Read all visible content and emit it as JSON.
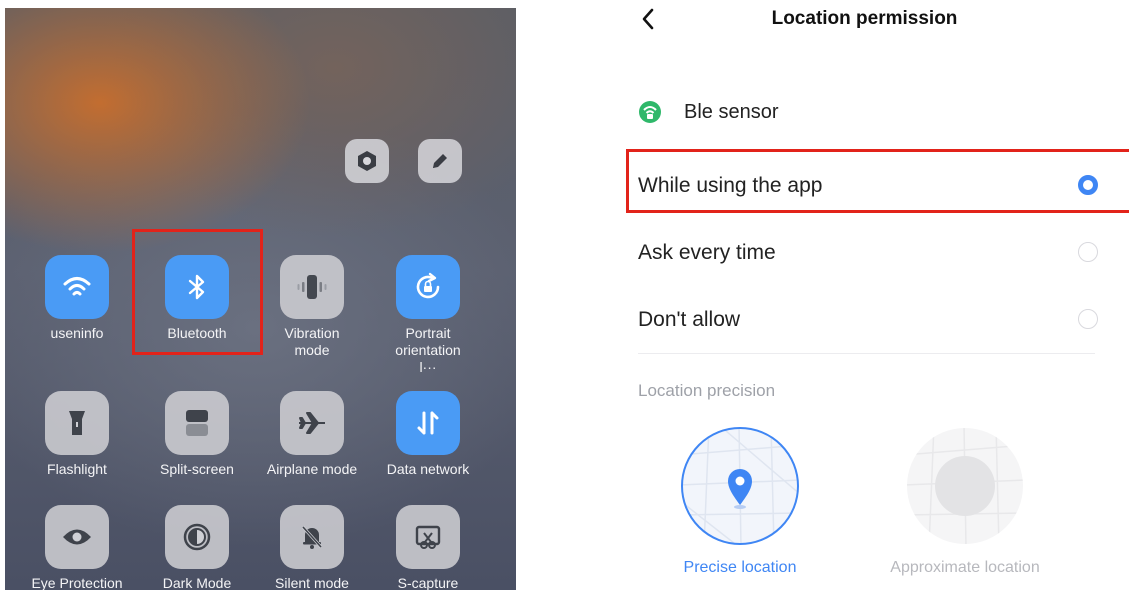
{
  "control_center": {
    "top_buttons": [
      {
        "icon": "settings-hex-icon"
      },
      {
        "icon": "pencil-icon"
      }
    ],
    "tiles": [
      {
        "label": "useninfo",
        "icon": "wifi-icon",
        "active": true
      },
      {
        "label": "Bluetooth",
        "icon": "bluetooth-icon",
        "active": true
      },
      {
        "label": "Vibration mode",
        "icon": "vibration-icon",
        "active": false
      },
      {
        "label": "Portrait orientation l···",
        "icon": "rotation-lock-icon",
        "active": true
      },
      {
        "label": "Flashlight",
        "icon": "flashlight-icon",
        "active": false
      },
      {
        "label": "Split-screen",
        "icon": "split-screen-icon",
        "active": false
      },
      {
        "label": "Airplane mode",
        "icon": "airplane-icon",
        "active": false
      },
      {
        "label": "Data network",
        "icon": "data-network-icon",
        "active": true
      },
      {
        "label": "Eye Protection",
        "icon": "eye-icon",
        "active": false
      },
      {
        "label": "Dark Mode",
        "icon": "dark-mode-icon",
        "active": false
      },
      {
        "label": "Silent mode",
        "icon": "silent-bell-icon",
        "active": false
      },
      {
        "label": "S-capture",
        "icon": "screenshot-icon",
        "active": false
      }
    ],
    "active_color": "#4a9bf5"
  },
  "permission": {
    "title": "Location permission",
    "app_name": "Ble sensor",
    "options": [
      {
        "label": "While using the app",
        "selected": true
      },
      {
        "label": "Ask every time",
        "selected": false
      },
      {
        "label": "Don't allow",
        "selected": false
      }
    ],
    "precision_label": "Location precision",
    "precise_label": "Precise location",
    "approximate_label": "Approximate location",
    "accent_color": "#3f86f4",
    "highlight_color": "#e2231a"
  }
}
